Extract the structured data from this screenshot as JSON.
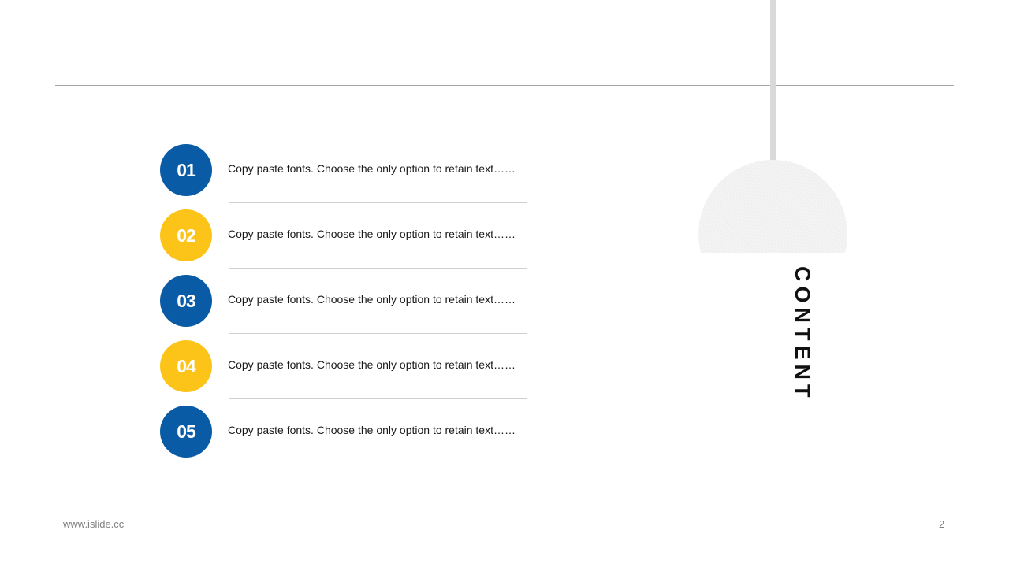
{
  "colors": {
    "blue": "#0a5ba6",
    "yellow": "#fcc419"
  },
  "section_title": "CONTENT",
  "items": [
    {
      "number": "01",
      "text": "Copy paste fonts. Choose the only option to retain text……",
      "color": "blue"
    },
    {
      "number": "02",
      "text": "Copy paste fonts. Choose the only option to retain text……",
      "color": "yellow"
    },
    {
      "number": "03",
      "text": "Copy paste fonts. Choose the only option to retain text……",
      "color": "blue"
    },
    {
      "number": "04",
      "text": "Copy paste fonts. Choose the only option to retain text……",
      "color": "yellow"
    },
    {
      "number": "05",
      "text": "Copy paste fonts. Choose the only option to retain text……",
      "color": "blue"
    }
  ],
  "footer": {
    "url": "www.islide.cc",
    "page_number": "2"
  }
}
